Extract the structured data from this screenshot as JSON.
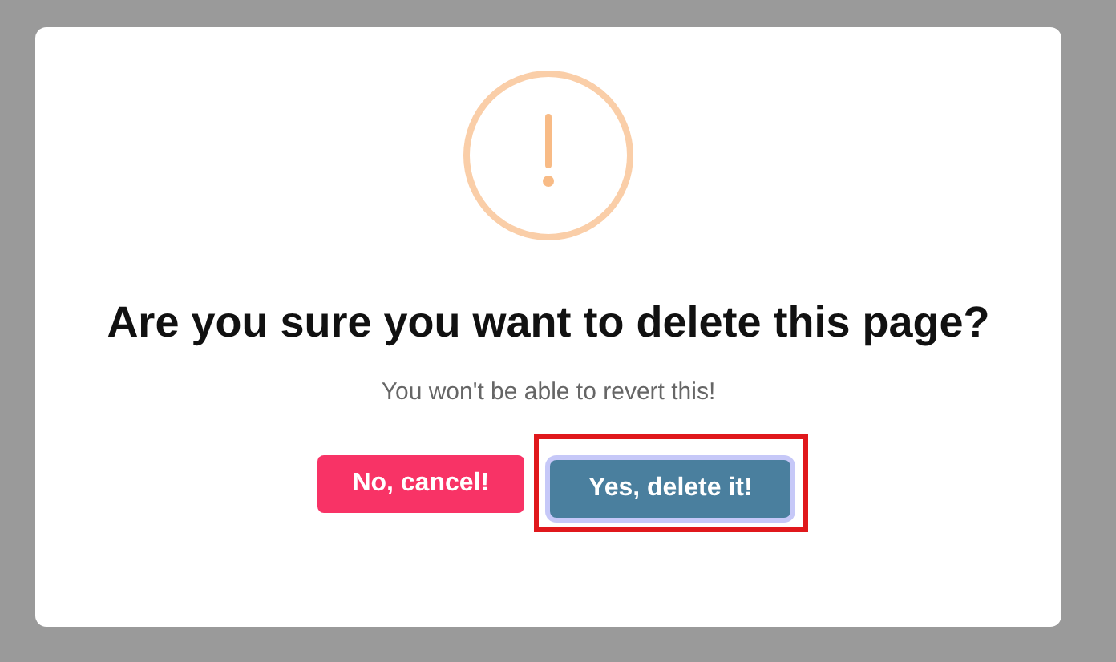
{
  "dialog": {
    "icon": {
      "kind": "warning"
    },
    "title": "Are you sure you want to delete this page?",
    "text": "You won't be able to revert this!",
    "buttons": [
      {
        "label": "No, cancel!",
        "kind": "cancel",
        "focused": false,
        "highlighted": false
      },
      {
        "label": "Yes, delete it!",
        "kind": "confirm",
        "focused": true,
        "highlighted": true
      }
    ]
  }
}
